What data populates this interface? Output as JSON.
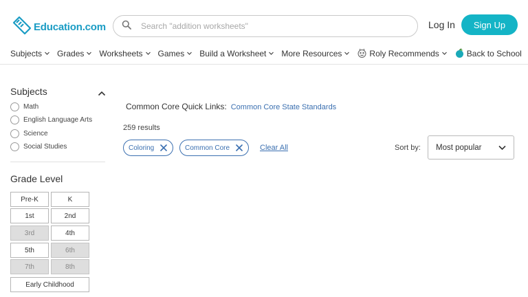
{
  "header": {
    "logo_text": "Education.com",
    "search_placeholder": "Search \"addition worksheets\"",
    "login_label": "Log In",
    "signup_label": "Sign Up",
    "brand_color": "#14b4c6"
  },
  "nav": {
    "items": [
      {
        "label": "Subjects"
      },
      {
        "label": "Grades"
      },
      {
        "label": "Worksheets"
      },
      {
        "label": "Games"
      },
      {
        "label": "Build a Worksheet"
      },
      {
        "label": "More Resources"
      },
      {
        "label": "Roly Recommends",
        "icon": "roly-icon"
      },
      {
        "label": "Back to School",
        "icon": "apple-icon"
      }
    ]
  },
  "sidebar": {
    "subjects_title": "Subjects",
    "subjects": [
      "Math",
      "English Language Arts",
      "Science",
      "Social Studies"
    ],
    "grade_title": "Grade Level",
    "grades": [
      {
        "label": "Pre-K",
        "disabled": false
      },
      {
        "label": "K",
        "disabled": false
      },
      {
        "label": "1st",
        "disabled": false
      },
      {
        "label": "2nd",
        "disabled": false
      },
      {
        "label": "3rd",
        "disabled": true
      },
      {
        "label": "4th",
        "disabled": false
      },
      {
        "label": "5th",
        "disabled": false
      },
      {
        "label": "6th",
        "disabled": true
      },
      {
        "label": "7th",
        "disabled": true
      },
      {
        "label": "8th",
        "disabled": true
      },
      {
        "label": "Early Childhood",
        "disabled": false
      }
    ]
  },
  "main": {
    "quicklinks_label": "Common Core Quick Links:",
    "quicklinks_link": "Common Core State Standards",
    "results_count": "259 results",
    "filters": [
      "Coloring",
      "Common Core"
    ],
    "clear_all": "Clear All",
    "sort_label": "Sort by:",
    "sort_value": "Most popular",
    "link_color": "#3a6fb0"
  }
}
